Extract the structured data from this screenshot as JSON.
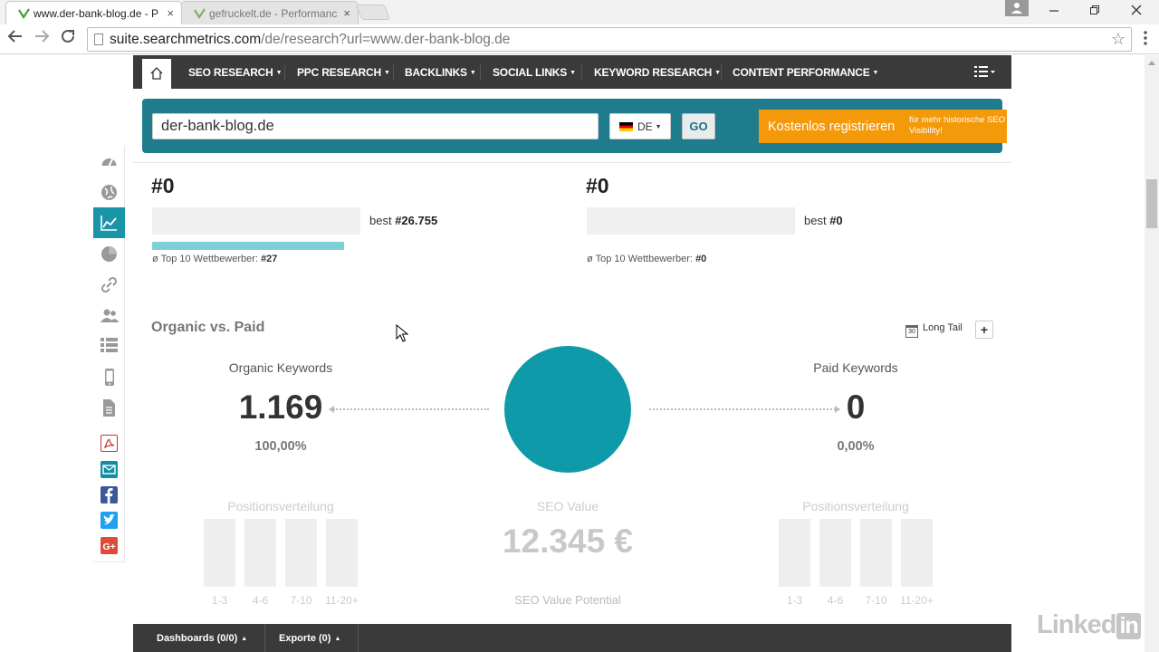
{
  "browser": {
    "tabs": [
      {
        "title": "www.der-bank-blog.de - P",
        "active": true
      },
      {
        "title": "gefruckelt.de - Performanc",
        "active": false
      }
    ],
    "url_host": "suite.searchmetrics.com",
    "url_path": "/de/research?url=www.der-bank-blog.de",
    "tab_close_symbol": "×"
  },
  "nav": {
    "items": [
      {
        "label": "SEO RESEARCH"
      },
      {
        "label": "PPC RESEARCH"
      },
      {
        "label": "BACKLINKS"
      },
      {
        "label": "SOCIAL LINKS"
      },
      {
        "label": "KEYWORD RESEARCH"
      },
      {
        "label": "CONTENT PERFORMANCE"
      }
    ]
  },
  "search": {
    "value": "der-bank-blog.de",
    "country": "DE",
    "go_label": "GO",
    "register_label": "Kostenlos registrieren",
    "register_sub": "für mehr historische SEO Visibility!"
  },
  "ranks": {
    "left": {
      "rank": "#0",
      "best_label": "best",
      "best_value": "#26.755",
      "avg_label": "ø Top 10 Wettbewerber:",
      "avg_value": "#27",
      "progress": 0.92
    },
    "right": {
      "rank": "#0",
      "best_label": "best",
      "best_value": "#0",
      "avg_label": "ø Top 10 Wettbewerber:",
      "avg_value": "#0",
      "progress": 0
    }
  },
  "organic_paid": {
    "title": "Organic vs. Paid",
    "long_tail_label": "Long Tail",
    "calendar_number": "30",
    "plus_label": "+",
    "organic": {
      "label": "Organic Keywords",
      "value": "1.169",
      "pct": "100,00%"
    },
    "paid": {
      "label": "Paid Keywords",
      "value": "0",
      "pct": "0,00%"
    },
    "pie_color": "#0e9aa8"
  },
  "distribution": {
    "left_title": "Positionsverteilung",
    "right_title": "Positionsverteilung",
    "labels": [
      "1-3",
      "4-6",
      "7-10",
      "11-20+"
    ],
    "seo_value_title": "SEO Value",
    "seo_value": "12.345 €",
    "seo_value_potential": "SEO Value Potential"
  },
  "bottom": {
    "dashboards": "Dashboards (0/0)",
    "exports": "Exporte (0)"
  },
  "watermark": {
    "text": "Linked",
    "in": "in"
  },
  "colors": {
    "accent": "#1e7c8c",
    "register": "#f49a0a",
    "nav": "#3a3a3a"
  }
}
